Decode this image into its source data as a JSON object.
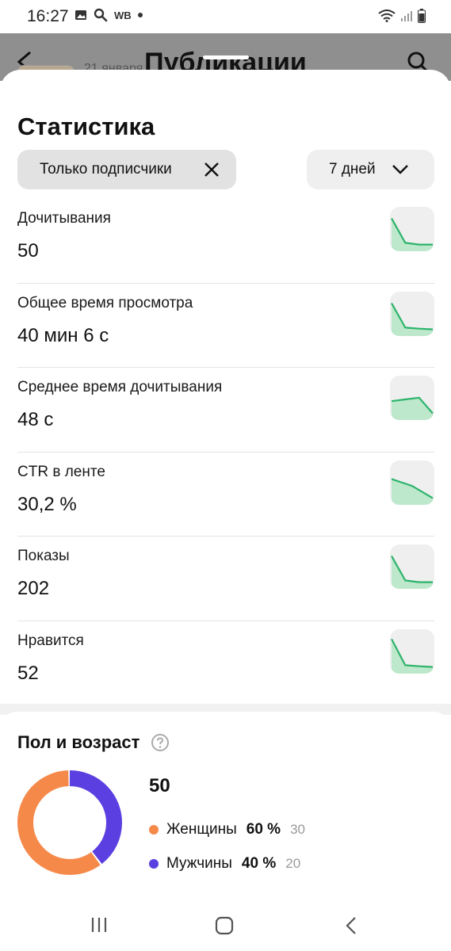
{
  "status_bar": {
    "time": "16:27",
    "carrier_badge": "WB",
    "icons": [
      "image-icon",
      "search-icon",
      "wifi-icon",
      "signal-icon",
      "battery-icon"
    ]
  },
  "background_screen": {
    "title": "Публикации",
    "post_date": "21 января"
  },
  "sheet": {
    "title": "Статистика",
    "filter_chip": "Только подписчики",
    "period": "7 дней",
    "metrics": [
      {
        "label": "Дочитывания",
        "value": "50",
        "spark": [
          0.15,
          0.85,
          0.9,
          0.9
        ]
      },
      {
        "label": "Общее время просмотра",
        "value": "40 мин 6 с",
        "spark": [
          0.15,
          0.85,
          0.88,
          0.9
        ]
      },
      {
        "label": "Среднее время дочитывания",
        "value": "48 с",
        "spark": [
          0.55,
          0.5,
          0.45,
          0.9
        ]
      },
      {
        "label": "CTR в ленте",
        "value": "30,2 %",
        "spark": [
          0.35,
          0.55,
          0.9
        ]
      },
      {
        "label": "Показы",
        "value": "202",
        "spark": [
          0.15,
          0.85,
          0.9,
          0.9
        ]
      },
      {
        "label": "Нравится",
        "value": "52",
        "spark": [
          0.1,
          0.85,
          0.88,
          0.9
        ]
      }
    ]
  },
  "gender_age": {
    "title": "Пол и возраст",
    "total": "50",
    "women": {
      "label": "Женщины",
      "percent": "60 %",
      "count": "30",
      "share": 0.6,
      "color": "#F5894A"
    },
    "men": {
      "label": "Мужчины",
      "percent": "40 %",
      "count": "20",
      "share": 0.4,
      "color": "#5B3FE0"
    }
  },
  "colors": {
    "spark_line": "#2DB36B",
    "spark_fill": "#BDE8CC"
  }
}
